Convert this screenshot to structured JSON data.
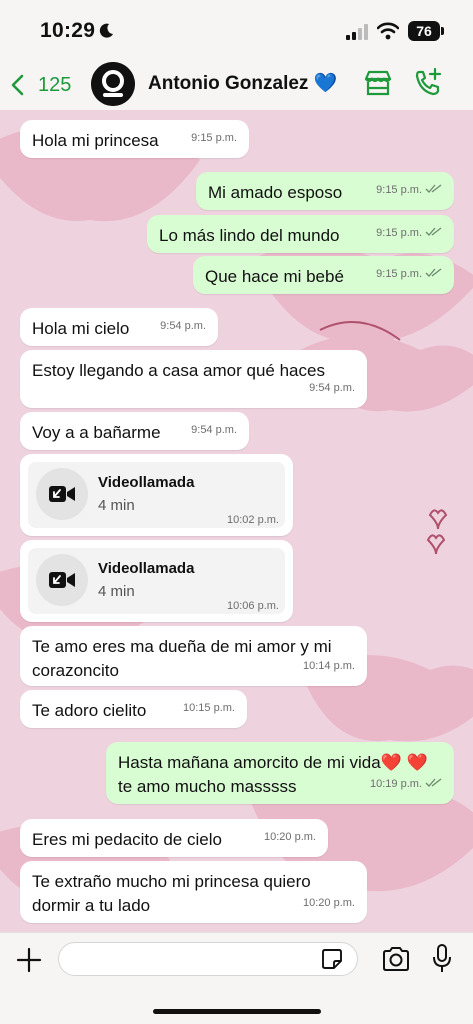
{
  "status_bar": {
    "time": "10:29",
    "battery": "76"
  },
  "header": {
    "back_count": "125",
    "contact_name": "Antonio Gonzalez",
    "contact_emoji": "💙",
    "accent_color": "#1f9a3b"
  },
  "messages": [
    {
      "dir": "in",
      "text": "Hola mi princesa",
      "time": "9:15 p.m."
    },
    {
      "dir": "out",
      "text": "Mi amado esposo",
      "time": "9:15 p.m."
    },
    {
      "dir": "out",
      "text": "Lo más lindo del mundo",
      "time": "9:15 p.m."
    },
    {
      "dir": "out",
      "text": "Que hace mi bebé",
      "time": "9:15 p.m."
    },
    {
      "dir": "in",
      "text": "Hola mi cielo",
      "time": "9:54 p.m."
    },
    {
      "dir": "in",
      "text": "Estoy llegando a casa amor qué haces",
      "time": "9:54 p.m."
    },
    {
      "dir": "in",
      "text": "Voy a a bañarme",
      "time": "9:54 p.m."
    },
    {
      "dir": "in",
      "text": "Te amo eres ma dueña de mi amor y mi corazoncito",
      "time": "10:14 p.m."
    },
    {
      "dir": "in",
      "text": "Te adoro cielito",
      "time": "10:15 p.m."
    },
    {
      "dir": "out",
      "text": "Hasta mañana amorcito de mi vida❤️ ❤️ te amo mucho masssss",
      "time": "10:19 p.m."
    },
    {
      "dir": "in",
      "text": "Eres mi pedacito de cielo",
      "time": "10:20 p.m."
    },
    {
      "dir": "in",
      "text": "Te extraño mucho mi princesa quiero dormir a tu lado",
      "time": "10:20 p.m."
    }
  ],
  "calls": [
    {
      "title": "Videollamada",
      "duration": "4 min",
      "time": "10:02 p.m."
    },
    {
      "title": "Videollamada",
      "duration": "4 min",
      "time": "10:06 p.m."
    }
  ],
  "input": {
    "placeholder": ""
  },
  "icons": {
    "back": "chevron-left-icon",
    "shop": "store-icon",
    "call": "add-call-icon",
    "plus": "plus-icon",
    "sticker": "sticker-icon",
    "camera": "camera-icon",
    "mic": "microphone-icon",
    "video": "video-camera-icon"
  }
}
